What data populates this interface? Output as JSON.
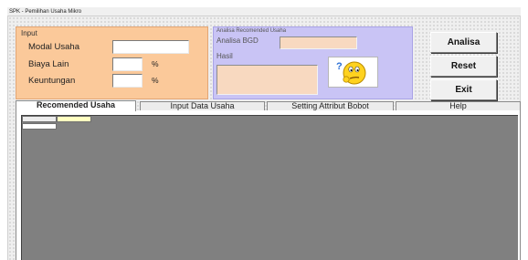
{
  "window": {
    "title": "SPK - Pemilihan Usaha Mikro"
  },
  "input_panel": {
    "title": "Input",
    "modal_label": "Modal Usaha",
    "modal_value": "",
    "biaya_label": "Biaya Lain",
    "biaya_value": "",
    "biaya_unit": "%",
    "keuntungan_label": "Keuntungan",
    "keuntungan_value": "",
    "keuntungan_unit": "%"
  },
  "analisa_panel": {
    "title": "Analisa Recomended Usaha",
    "bgd_label": "Analisa BGD",
    "bgd_value": "",
    "hasil_label": "Hasil",
    "hasil_value": "",
    "image_icon": "thinking-smiley-icon"
  },
  "buttons": {
    "analisa": "Analisa",
    "reset": "Reset",
    "exit": "Exit"
  },
  "tabs": [
    {
      "label": "Recomended Usaha",
      "active": true
    },
    {
      "label": "Input Data Usaha",
      "active": false
    },
    {
      "label": "Setting Attribut Bobot",
      "active": false
    },
    {
      "label": "Help",
      "active": false
    }
  ],
  "colors": {
    "input_panel": "#fbc99a",
    "analisa_panel": "#c9c4f5",
    "field_peach": "#f8d9c0",
    "grid_background": "#808080",
    "grid_cell_highlight": "#ffffc0"
  }
}
